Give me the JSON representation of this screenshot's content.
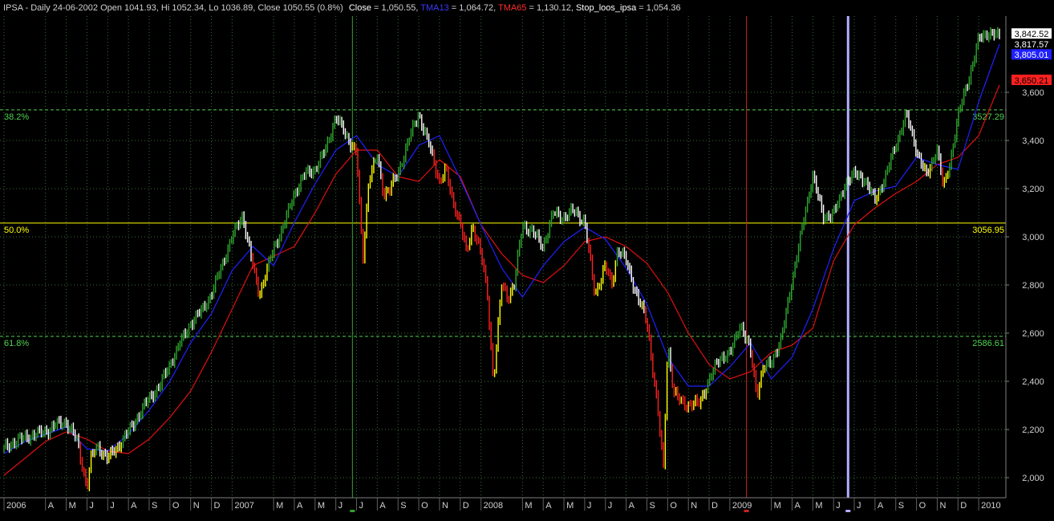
{
  "header": {
    "instrument_line": "IPSA - Daily 24-06-2002 Open 1041.93, Hi 1052.34, Lo 1036.89, Close 1050.55 (0.8%)",
    "close_label": "Close",
    "close_value": " = 1,050.55, ",
    "tma13_label": "TMA13",
    "tma13_value": " = 1,064.72, ",
    "tma65_label": "TMA65",
    "tma65_value": " = 1,130.12, ",
    "stop_label": "Stop_loos_ipsa",
    "stop_value": " = 1,054.36"
  },
  "colors": {
    "background": "#000000",
    "grid": "#3a6e3a",
    "axis_text": "#d0d0d0",
    "bar_up": "#2ea52e",
    "bar_down": "#ffffff",
    "bar_neutral": "#ffff00",
    "bar_red": "#ff2020",
    "tma13": "#2020ff",
    "tma65": "#e01010",
    "fib_382": "#4fd24f",
    "fib_50": "#ffff00",
    "fib_618": "#4fd24f",
    "cursor_green": "#2ea52e",
    "cursor_red": "#d02020",
    "cursor_lavender": "#b0b0ff"
  },
  "chart_data": {
    "type": "line",
    "title": "IPSA - Daily",
    "y_scale": {
      "min": 1950,
      "max": 3900
    },
    "y_ticks": [
      2000,
      2200,
      2400,
      2600,
      2800,
      3000,
      3200,
      3400,
      3600
    ],
    "y_tick_labels": [
      "2,000",
      "2,200",
      "2,400",
      "2,600",
      "2,800",
      "3,000",
      "3,200",
      "3,400",
      "3,600"
    ],
    "x_ticks": [
      {
        "label": "2006",
        "t": 0
      },
      {
        "label": "A",
        "t": 2
      },
      {
        "label": "M",
        "t": 3
      },
      {
        "label": "J",
        "t": 4
      },
      {
        "label": "J",
        "t": 5
      },
      {
        "label": "A",
        "t": 6
      },
      {
        "label": "S",
        "t": 7
      },
      {
        "label": "O",
        "t": 8
      },
      {
        "label": "N",
        "t": 9
      },
      {
        "label": "D",
        "t": 10
      },
      {
        "label": "2007",
        "t": 11
      },
      {
        "label": "M",
        "t": 13
      },
      {
        "label": "A",
        "t": 14
      },
      {
        "label": "M",
        "t": 15
      },
      {
        "label": "J",
        "t": 16
      },
      {
        "label": "J",
        "t": 17
      },
      {
        "label": "A",
        "t": 18
      },
      {
        "label": "S",
        "t": 19
      },
      {
        "label": "O",
        "t": 20
      },
      {
        "label": "N",
        "t": 21
      },
      {
        "label": "D",
        "t": 22
      },
      {
        "label": "2008",
        "t": 23
      },
      {
        "label": "M",
        "t": 25
      },
      {
        "label": "A",
        "t": 26
      },
      {
        "label": "M",
        "t": 27
      },
      {
        "label": "J",
        "t": 28
      },
      {
        "label": "J",
        "t": 29
      },
      {
        "label": "A",
        "t": 30
      },
      {
        "label": "S",
        "t": 31
      },
      {
        "label": "O",
        "t": 32
      },
      {
        "label": "N",
        "t": 33
      },
      {
        "label": "D",
        "t": 34
      },
      {
        "label": "2009",
        "t": 35
      },
      {
        "label": "M",
        "t": 37
      },
      {
        "label": "A",
        "t": 38
      },
      {
        "label": "M",
        "t": 39
      },
      {
        "label": "J",
        "t": 40
      },
      {
        "label": "J",
        "t": 41
      },
      {
        "label": "A",
        "t": 42
      },
      {
        "label": "S",
        "t": 43
      },
      {
        "label": "O",
        "t": 44
      },
      {
        "label": "N",
        "t": 45
      },
      {
        "label": "D",
        "t": 46
      },
      {
        "label": "2010",
        "t": 47
      }
    ],
    "fib_levels": [
      {
        "name": "38.2%",
        "value": 3527.29,
        "label": "3527.29",
        "color": "#4fd24f",
        "style": "dashed"
      },
      {
        "name": "50.0%",
        "value": 3056.95,
        "label": "3056.95",
        "color": "#ffff00",
        "style": "solid"
      },
      {
        "name": "61.8%",
        "value": 2586.61,
        "label": "2586.61",
        "color": "#4fd24f",
        "style": "dashed"
      }
    ],
    "value_tags": [
      {
        "text": "3,842.52",
        "value": 3842.52,
        "bg": "#ffffff",
        "fg": "#000000"
      },
      {
        "text": "3,817.57",
        "value": 3817.57,
        "bg": "#000000",
        "fg": "#ffffff"
      },
      {
        "text": "3,805.01",
        "value": 3805.01,
        "bg": "#2020ff",
        "fg": "#ffffff"
      },
      {
        "text": "3,650.21",
        "value": 3650.21,
        "bg": "#ff2020",
        "fg": "#000000"
      }
    ],
    "vertical_markers": [
      {
        "t": 16.8,
        "color": "#2ea52e"
      },
      {
        "t": 35.8,
        "color": "#d02020"
      },
      {
        "t": 40.7,
        "color": "#b0b0ff"
      }
    ],
    "series": [
      {
        "name": "Close",
        "x": [
          0,
          0.5,
          1,
          1.5,
          2,
          2.5,
          3,
          3.5,
          4,
          4.2,
          4.5,
          5,
          5.5,
          6,
          6.5,
          7,
          7.5,
          8,
          8.5,
          9,
          9.5,
          10,
          10.5,
          11,
          11.5,
          12,
          12.3,
          12.6,
          13,
          13.5,
          14,
          14.5,
          15,
          15.5,
          16,
          16.5,
          17,
          17.3,
          17.6,
          18,
          18.3,
          18.6,
          19,
          19.5,
          20,
          20.5,
          21,
          21.3,
          21.6,
          22,
          22.3,
          22.6,
          23,
          23.3,
          23.6,
          24,
          24.3,
          24.6,
          25,
          25.5,
          26,
          26.5,
          27,
          27.5,
          28,
          28.5,
          29,
          29.3,
          29.6,
          30,
          30.5,
          31,
          31.5,
          31.8,
          32,
          32.3,
          32.6,
          33,
          33.5,
          34,
          34.5,
          35,
          35.5,
          36,
          36.3,
          36.6,
          37,
          37.5,
          38,
          38.5,
          39,
          39.5,
          40,
          40.3,
          40.6,
          41,
          41.5,
          42,
          42.5,
          43,
          43.5,
          44,
          44.5,
          45,
          45.3,
          45.6,
          46,
          46.5,
          47,
          47.5,
          48
        ],
        "values": [
          2120,
          2150,
          2165,
          2180,
          2190,
          2220,
          2230,
          2160,
          1960,
          2080,
          2130,
          2080,
          2130,
          2190,
          2260,
          2330,
          2380,
          2470,
          2560,
          2640,
          2690,
          2760,
          2880,
          3000,
          3090,
          2880,
          2760,
          2840,
          2950,
          3050,
          3180,
          3260,
          3280,
          3360,
          3500,
          3420,
          3350,
          2900,
          3250,
          3330,
          3180,
          3200,
          3260,
          3400,
          3510,
          3380,
          3230,
          3280,
          3160,
          3060,
          2930,
          3050,
          2930,
          2770,
          2400,
          2800,
          2750,
          2800,
          3050,
          3020,
          2960,
          3100,
          3080,
          3110,
          3060,
          2760,
          2880,
          2800,
          2950,
          2900,
          2760,
          2650,
          2300,
          2040,
          2560,
          2350,
          2320,
          2300,
          2310,
          2400,
          2500,
          2510,
          2640,
          2520,
          2350,
          2450,
          2480,
          2580,
          2820,
          3040,
          3260,
          3080,
          3100,
          3150,
          3230,
          3260,
          3240,
          3150,
          3250,
          3380,
          3510,
          3360,
          3250,
          3370,
          3200,
          3300,
          3500,
          3650,
          3820,
          3850,
          3830
        ]
      },
      {
        "name": "TMA13",
        "x": [
          0,
          1,
          2,
          3,
          4,
          5,
          6,
          7,
          8,
          9,
          10,
          11,
          12,
          13,
          14,
          15,
          16,
          17,
          18,
          19,
          20,
          21,
          22,
          23,
          24,
          25,
          26,
          27,
          28,
          29,
          30,
          31,
          32,
          33,
          34,
          35,
          36,
          37,
          38,
          39,
          40,
          41,
          42,
          43,
          44,
          45,
          46,
          47,
          48
        ],
        "values": [
          2100,
          2150,
          2180,
          2210,
          2120,
          2110,
          2180,
          2280,
          2400,
          2560,
          2680,
          2860,
          2960,
          2880,
          3060,
          3220,
          3360,
          3420,
          3300,
          3250,
          3380,
          3420,
          3240,
          3050,
          2870,
          2750,
          2880,
          2980,
          3040,
          2990,
          2870,
          2720,
          2500,
          2380,
          2380,
          2460,
          2560,
          2410,
          2500,
          2700,
          2950,
          3150,
          3190,
          3210,
          3330,
          3300,
          3280,
          3560,
          3800
        ]
      },
      {
        "name": "TMA65",
        "x": [
          0,
          1,
          2,
          3,
          4,
          5,
          6,
          7,
          8,
          9,
          10,
          11,
          12,
          13,
          14,
          15,
          16,
          17,
          18,
          19,
          20,
          21,
          22,
          23,
          24,
          25,
          26,
          27,
          28,
          29,
          30,
          31,
          32,
          33,
          34,
          35,
          36,
          37,
          38,
          39,
          40,
          41,
          42,
          43,
          44,
          45,
          46,
          47,
          48
        ],
        "values": [
          2010,
          2080,
          2150,
          2190,
          2160,
          2110,
          2100,
          2160,
          2250,
          2360,
          2520,
          2700,
          2880,
          2920,
          2960,
          3100,
          3260,
          3360,
          3360,
          3250,
          3230,
          3320,
          3250,
          3050,
          2930,
          2840,
          2810,
          2880,
          2980,
          3000,
          2960,
          2890,
          2770,
          2600,
          2470,
          2410,
          2440,
          2520,
          2550,
          2620,
          2900,
          3050,
          3120,
          3180,
          3230,
          3300,
          3330,
          3420,
          3630
        ]
      }
    ]
  }
}
